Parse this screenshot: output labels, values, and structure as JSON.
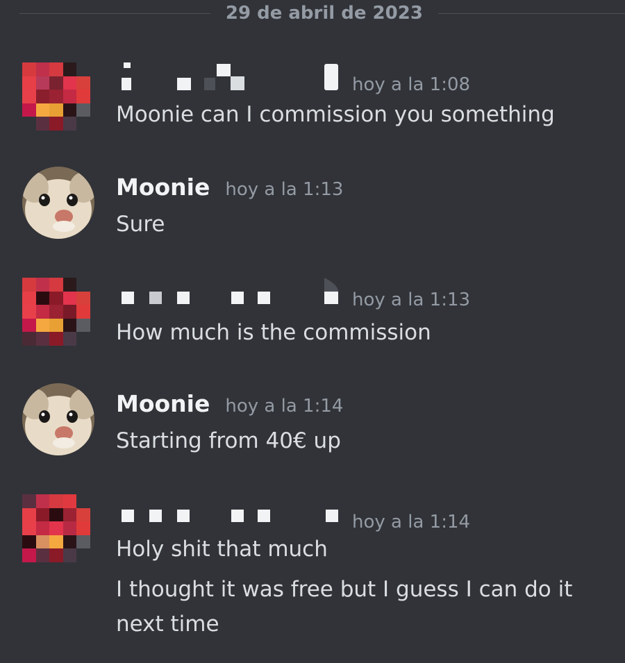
{
  "date_divider": "29 de abril de 2023",
  "messages": [
    {
      "author": "",
      "author_redacted": true,
      "timestamp": "hoy a la 1:08",
      "lines": [
        "Moonie can I commission you something"
      ]
    },
    {
      "author": "Moonie",
      "author_redacted": false,
      "timestamp": "hoy a la 1:13",
      "lines": [
        "Sure"
      ]
    },
    {
      "author": "",
      "author_redacted": true,
      "timestamp": "hoy a la 1:13",
      "lines": [
        "How much is the commission"
      ]
    },
    {
      "author": "Moonie",
      "author_redacted": false,
      "timestamp": "hoy a la 1:14",
      "lines": [
        "Starting from 40€ up"
      ]
    },
    {
      "author": "",
      "author_redacted": true,
      "timestamp": "hoy a la 1:14",
      "lines": [
        "Holy shit that much",
        "I thought it was free but I guess I can do it next time"
      ]
    }
  ],
  "colors": {
    "background": "#313338",
    "text": "#dbdee1",
    "muted": "#949ba4",
    "username": "#f2f3f5"
  }
}
